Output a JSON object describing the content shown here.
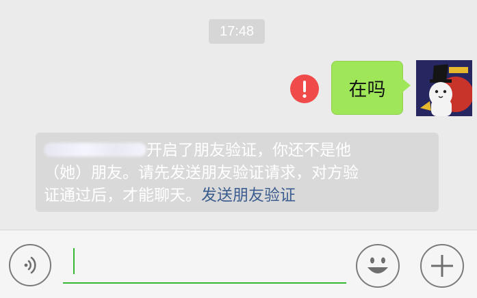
{
  "chat": {
    "timestamp": "17:48",
    "message": {
      "text": "在吗",
      "status": "send-failed",
      "bubble_color": "#9fe659",
      "error_color": "#f04a4a"
    },
    "avatar": {
      "icon": "cat-wizard-avatar"
    },
    "system_notice": {
      "line1_text": "开启了朋友验证，你还不是他",
      "line2_text": "（她）朋友。请先发送朋友验证请求，对方验",
      "line3_text": "证通过后，才能聊天。",
      "link_text": "发送朋友验证",
      "link_color": "#3c5d8f"
    }
  },
  "input_bar": {
    "voice_icon": "voice-icon",
    "emoji_icon": "emoji-icon",
    "plus_icon": "plus-icon",
    "accent_color": "#35b934"
  }
}
